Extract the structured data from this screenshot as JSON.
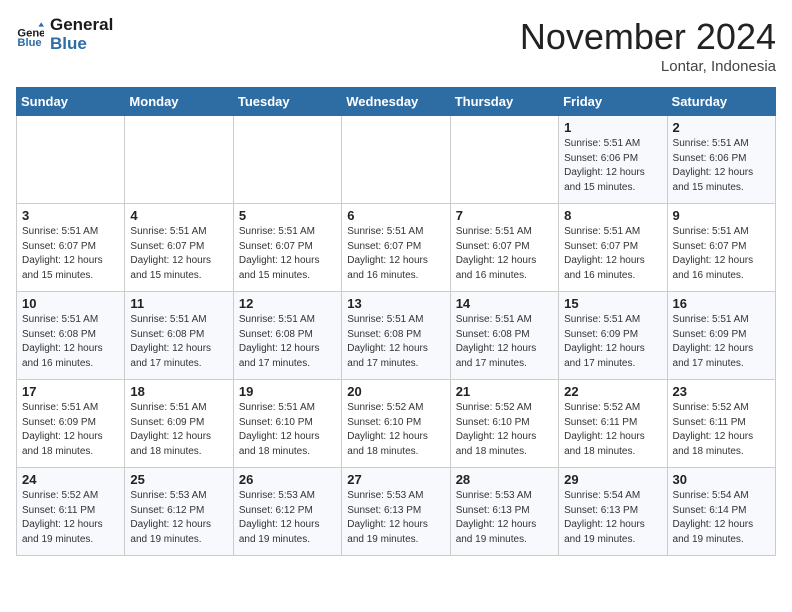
{
  "header": {
    "logo_line1": "General",
    "logo_line2": "Blue",
    "title": "November 2024",
    "subtitle": "Lontar, Indonesia"
  },
  "columns": [
    "Sunday",
    "Monday",
    "Tuesday",
    "Wednesday",
    "Thursday",
    "Friday",
    "Saturday"
  ],
  "weeks": [
    [
      {
        "day": "",
        "info": ""
      },
      {
        "day": "",
        "info": ""
      },
      {
        "day": "",
        "info": ""
      },
      {
        "day": "",
        "info": ""
      },
      {
        "day": "",
        "info": ""
      },
      {
        "day": "1",
        "info": "Sunrise: 5:51 AM\nSunset: 6:06 PM\nDaylight: 12 hours\nand 15 minutes."
      },
      {
        "day": "2",
        "info": "Sunrise: 5:51 AM\nSunset: 6:06 PM\nDaylight: 12 hours\nand 15 minutes."
      }
    ],
    [
      {
        "day": "3",
        "info": "Sunrise: 5:51 AM\nSunset: 6:07 PM\nDaylight: 12 hours\nand 15 minutes."
      },
      {
        "day": "4",
        "info": "Sunrise: 5:51 AM\nSunset: 6:07 PM\nDaylight: 12 hours\nand 15 minutes."
      },
      {
        "day": "5",
        "info": "Sunrise: 5:51 AM\nSunset: 6:07 PM\nDaylight: 12 hours\nand 15 minutes."
      },
      {
        "day": "6",
        "info": "Sunrise: 5:51 AM\nSunset: 6:07 PM\nDaylight: 12 hours\nand 16 minutes."
      },
      {
        "day": "7",
        "info": "Sunrise: 5:51 AM\nSunset: 6:07 PM\nDaylight: 12 hours\nand 16 minutes."
      },
      {
        "day": "8",
        "info": "Sunrise: 5:51 AM\nSunset: 6:07 PM\nDaylight: 12 hours\nand 16 minutes."
      },
      {
        "day": "9",
        "info": "Sunrise: 5:51 AM\nSunset: 6:07 PM\nDaylight: 12 hours\nand 16 minutes."
      }
    ],
    [
      {
        "day": "10",
        "info": "Sunrise: 5:51 AM\nSunset: 6:08 PM\nDaylight: 12 hours\nand 16 minutes."
      },
      {
        "day": "11",
        "info": "Sunrise: 5:51 AM\nSunset: 6:08 PM\nDaylight: 12 hours\nand 17 minutes."
      },
      {
        "day": "12",
        "info": "Sunrise: 5:51 AM\nSunset: 6:08 PM\nDaylight: 12 hours\nand 17 minutes."
      },
      {
        "day": "13",
        "info": "Sunrise: 5:51 AM\nSunset: 6:08 PM\nDaylight: 12 hours\nand 17 minutes."
      },
      {
        "day": "14",
        "info": "Sunrise: 5:51 AM\nSunset: 6:08 PM\nDaylight: 12 hours\nand 17 minutes."
      },
      {
        "day": "15",
        "info": "Sunrise: 5:51 AM\nSunset: 6:09 PM\nDaylight: 12 hours\nand 17 minutes."
      },
      {
        "day": "16",
        "info": "Sunrise: 5:51 AM\nSunset: 6:09 PM\nDaylight: 12 hours\nand 17 minutes."
      }
    ],
    [
      {
        "day": "17",
        "info": "Sunrise: 5:51 AM\nSunset: 6:09 PM\nDaylight: 12 hours\nand 18 minutes."
      },
      {
        "day": "18",
        "info": "Sunrise: 5:51 AM\nSunset: 6:09 PM\nDaylight: 12 hours\nand 18 minutes."
      },
      {
        "day": "19",
        "info": "Sunrise: 5:51 AM\nSunset: 6:10 PM\nDaylight: 12 hours\nand 18 minutes."
      },
      {
        "day": "20",
        "info": "Sunrise: 5:52 AM\nSunset: 6:10 PM\nDaylight: 12 hours\nand 18 minutes."
      },
      {
        "day": "21",
        "info": "Sunrise: 5:52 AM\nSunset: 6:10 PM\nDaylight: 12 hours\nand 18 minutes."
      },
      {
        "day": "22",
        "info": "Sunrise: 5:52 AM\nSunset: 6:11 PM\nDaylight: 12 hours\nand 18 minutes."
      },
      {
        "day": "23",
        "info": "Sunrise: 5:52 AM\nSunset: 6:11 PM\nDaylight: 12 hours\nand 18 minutes."
      }
    ],
    [
      {
        "day": "24",
        "info": "Sunrise: 5:52 AM\nSunset: 6:11 PM\nDaylight: 12 hours\nand 19 minutes."
      },
      {
        "day": "25",
        "info": "Sunrise: 5:53 AM\nSunset: 6:12 PM\nDaylight: 12 hours\nand 19 minutes."
      },
      {
        "day": "26",
        "info": "Sunrise: 5:53 AM\nSunset: 6:12 PM\nDaylight: 12 hours\nand 19 minutes."
      },
      {
        "day": "27",
        "info": "Sunrise: 5:53 AM\nSunset: 6:13 PM\nDaylight: 12 hours\nand 19 minutes."
      },
      {
        "day": "28",
        "info": "Sunrise: 5:53 AM\nSunset: 6:13 PM\nDaylight: 12 hours\nand 19 minutes."
      },
      {
        "day": "29",
        "info": "Sunrise: 5:54 AM\nSunset: 6:13 PM\nDaylight: 12 hours\nand 19 minutes."
      },
      {
        "day": "30",
        "info": "Sunrise: 5:54 AM\nSunset: 6:14 PM\nDaylight: 12 hours\nand 19 minutes."
      }
    ]
  ]
}
